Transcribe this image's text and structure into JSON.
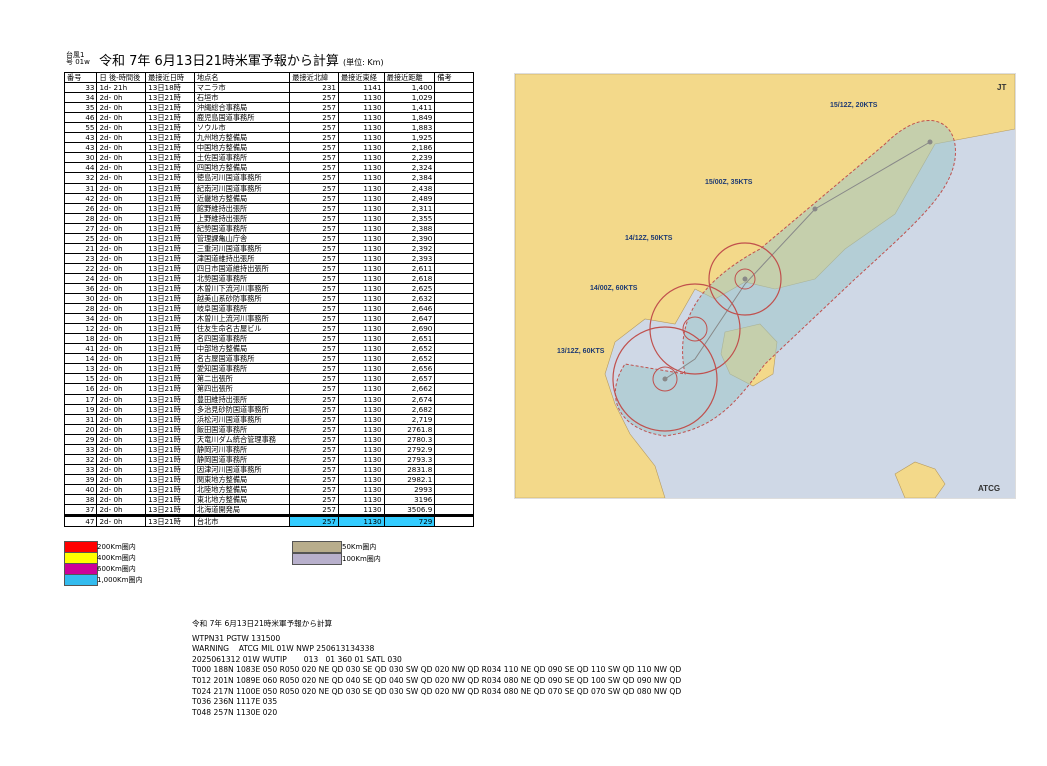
{
  "header": {
    "storm_id_line1": "台風1",
    "storm_id_line2": "号 01w",
    "title": "令和 7年 6月13日21時米軍予報から計算",
    "unit": "(単位: Km)"
  },
  "table": {
    "headers": [
      "番号",
      "日 後-時間後",
      "最接近日時",
      "地点名",
      "最接近北緯",
      "最接近東経",
      "最接近距離",
      "備考"
    ],
    "rows": [
      [
        "33",
        "1d- 21h",
        "13日18時",
        "マニラ市",
        "231",
        "1141",
        "1,400",
        ""
      ],
      [
        "34",
        "2d- 0h",
        "13日21時",
        "石垣市",
        "257",
        "1130",
        "1,029",
        ""
      ],
      [
        "35",
        "2d- 0h",
        "13日21時",
        "沖縄総合事務局",
        "257",
        "1130",
        "1,411",
        ""
      ],
      [
        "46",
        "2d- 0h",
        "13日21時",
        "鹿児島国道事務所",
        "257",
        "1130",
        "1,849",
        ""
      ],
      [
        "55",
        "2d- 0h",
        "13日21時",
        "ソウル市",
        "257",
        "1130",
        "1,883",
        ""
      ],
      [
        "43",
        "2d- 0h",
        "13日21時",
        "九州地方整備局",
        "257",
        "1130",
        "1,925",
        ""
      ],
      [
        "43",
        "2d- 0h",
        "13日21時",
        "中国地方整備局",
        "257",
        "1130",
        "2,186",
        ""
      ],
      [
        "30",
        "2d- 0h",
        "13日21時",
        "土佐国道事務所",
        "257",
        "1130",
        "2,239",
        ""
      ],
      [
        "44",
        "2d- 0h",
        "13日21時",
        "四国地方整備局",
        "257",
        "1130",
        "2,324",
        ""
      ],
      [
        "32",
        "2d- 0h",
        "13日21時",
        "徳島河川国道事務所",
        "257",
        "1130",
        "2,384",
        ""
      ],
      [
        "31",
        "2d- 0h",
        "13日21時",
        "紀南河川国道事務所",
        "257",
        "1130",
        "2,438",
        ""
      ],
      [
        "42",
        "2d- 0h",
        "13日21時",
        "近畿地方整備局",
        "257",
        "1130",
        "2,489",
        ""
      ],
      [
        "26",
        "2d- 0h",
        "13日21時",
        "館野維持出張所",
        "257",
        "1130",
        "2,311",
        ""
      ],
      [
        "28",
        "2d- 0h",
        "13日21時",
        "上野維持出張所",
        "257",
        "1130",
        "2,355",
        ""
      ],
      [
        "27",
        "2d- 0h",
        "13日21時",
        "紀勢国道事務所",
        "257",
        "1130",
        "2,388",
        ""
      ],
      [
        "25",
        "2d- 0h",
        "13日21時",
        "管理課亀山庁舎",
        "257",
        "1130",
        "2,390",
        ""
      ],
      [
        "21",
        "2d- 0h",
        "13日21時",
        "三重河川国道事務所",
        "257",
        "1130",
        "2,392",
        ""
      ],
      [
        "23",
        "2d- 0h",
        "13日21時",
        "津国道維持出張所",
        "257",
        "1130",
        "2,393",
        ""
      ],
      [
        "22",
        "2d- 0h",
        "13日21時",
        "四日市国道維持出張所",
        "257",
        "1130",
        "2,611",
        ""
      ],
      [
        "24",
        "2d- 0h",
        "13日21時",
        "北勢国道事務所",
        "257",
        "1130",
        "2,618",
        ""
      ],
      [
        "36",
        "2d- 0h",
        "13日21時",
        "木曽川下流河川事務所",
        "257",
        "1130",
        "2,625",
        ""
      ],
      [
        "30",
        "2d- 0h",
        "13日21時",
        "越美山系砂防事務所",
        "257",
        "1130",
        "2,632",
        ""
      ],
      [
        "28",
        "2d- 0h",
        "13日21時",
        "岐阜国道事務所",
        "257",
        "1130",
        "2,646",
        ""
      ],
      [
        "34",
        "2d- 0h",
        "13日21時",
        "木曽川上流河川事務所",
        "257",
        "1130",
        "2,647",
        ""
      ],
      [
        "12",
        "2d- 0h",
        "13日21時",
        "住友生命名古屋ビル",
        "257",
        "1130",
        "2,690",
        ""
      ],
      [
        "18",
        "2d- 0h",
        "13日21時",
        "名四国道事務所",
        "257",
        "1130",
        "2,651",
        ""
      ],
      [
        "41",
        "2d- 0h",
        "13日21時",
        "中部地方整備局",
        "257",
        "1130",
        "2,652",
        ""
      ],
      [
        "14",
        "2d- 0h",
        "13日21時",
        "名古屋国道事務所",
        "257",
        "1130",
        "2,652",
        ""
      ],
      [
        "13",
        "2d- 0h",
        "13日21時",
        "愛知国道事務所",
        "257",
        "1130",
        "2,656",
        ""
      ],
      [
        "15",
        "2d- 0h",
        "13日21時",
        "第二出張所",
        "257",
        "1130",
        "2,657",
        ""
      ],
      [
        "16",
        "2d- 0h",
        "13日21時",
        "第四出張所",
        "257",
        "1130",
        "2,662",
        ""
      ],
      [
        "17",
        "2d- 0h",
        "13日21時",
        "豊田維持出張所",
        "257",
        "1130",
        "2,674",
        ""
      ],
      [
        "19",
        "2d- 0h",
        "13日21時",
        "多治見砂防国道事務所",
        "257",
        "1130",
        "2,682",
        ""
      ],
      [
        "31",
        "2d- 0h",
        "13日21時",
        "浜松河川国道事務所",
        "257",
        "1130",
        "2,719",
        ""
      ],
      [
        "20",
        "2d- 0h",
        "13日21時",
        "飯田国道事務所",
        "257",
        "1130",
        "2761.8",
        ""
      ],
      [
        "29",
        "2d- 0h",
        "13日21時",
        "天竜川ダム統合管理事務",
        "257",
        "1130",
        "2780.3",
        ""
      ],
      [
        "33",
        "2d- 0h",
        "13日21時",
        "静岡河川事務所",
        "257",
        "1130",
        "2792.9",
        ""
      ],
      [
        "32",
        "2d- 0h",
        "13日21時",
        "静岡国道事務所",
        "257",
        "1130",
        "2793.3",
        ""
      ],
      [
        "33",
        "2d- 0h",
        "13日21時",
        "因津河川国道事務所",
        "257",
        "1130",
        "2831.8",
        ""
      ],
      [
        "39",
        "2d- 0h",
        "13日21時",
        "関東地方整備局",
        "257",
        "1130",
        "2982.1",
        ""
      ],
      [
        "40",
        "2d- 0h",
        "13日21時",
        "北陸地方整備局",
        "257",
        "1130",
        "2993",
        ""
      ],
      [
        "38",
        "2d- 0h",
        "13日21時",
        "東北地方整備局",
        "257",
        "1130",
        "3196",
        ""
      ],
      [
        "37",
        "2d- 0h",
        "13日21時",
        "北海道開発局",
        "257",
        "1130",
        "3506.9",
        ""
      ],
      [
        "47",
        "2d- 0h",
        "13日21時",
        "台北市",
        "257",
        "1130",
        "729",
        ""
      ]
    ]
  },
  "legend": {
    "left": [
      {
        "label": "200Km圏内",
        "color": "#ff0000"
      },
      {
        "label": "400Km圏内",
        "color": "#ffff00"
      },
      {
        "label": "600Km圏内",
        "color": "#cc0099"
      },
      {
        "label": "1,000Km圏内",
        "color": "#33bbee"
      }
    ],
    "right": [
      {
        "label": "50Km圏内",
        "color": "#b8ad8c"
      },
      {
        "label": "100Km圏内",
        "color": "#b8b0cc"
      }
    ]
  },
  "message": {
    "title": "令和 7年 6月13日21時米軍予報から計算",
    "lines": [
      "WTPN31 PGTW 131500",
      "WARNING    ATCG MIL 01W NWP 250613134338",
      "2025061312 01W WUTIP       013   01 360 01 SATL 030",
      "T000 188N 1083E 050 R050 020 NE QD 030 SE QD 030 SW QD 020 NW QD R034 110 NE QD 090 SE QD 110 SW QD 110 NW QD",
      "T012 201N 1089E 060 R050 020 NE QD 040 SE QD 040 SW QD 020 NW QD R034 080 NE QD 090 SE QD 100 SW QD 090 NW QD",
      "T024 217N 1100E 050 R050 020 NE QD 030 SE QD 030 SW QD 020 NW QD R034 080 NE QD 070 SE QD 070 SW QD 080 NW QD",
      "T036 236N 1117E 035",
      "T048 257N 1130E 020"
    ]
  },
  "map": {
    "labels": [
      "15/12Z, 20KTS",
      "15/00Z, 35KTS",
      "14/12Z, 50KTS",
      "14/00Z, 60KTS",
      "13/12Z, 60KTS"
    ],
    "corner": [
      "JT",
      "ATCG"
    ],
    "colors": {
      "land": "#f3d98a",
      "sea": "#cfd8e6",
      "cone": "#b5c9b0",
      "cone_sea": "#9fc7d6"
    }
  }
}
